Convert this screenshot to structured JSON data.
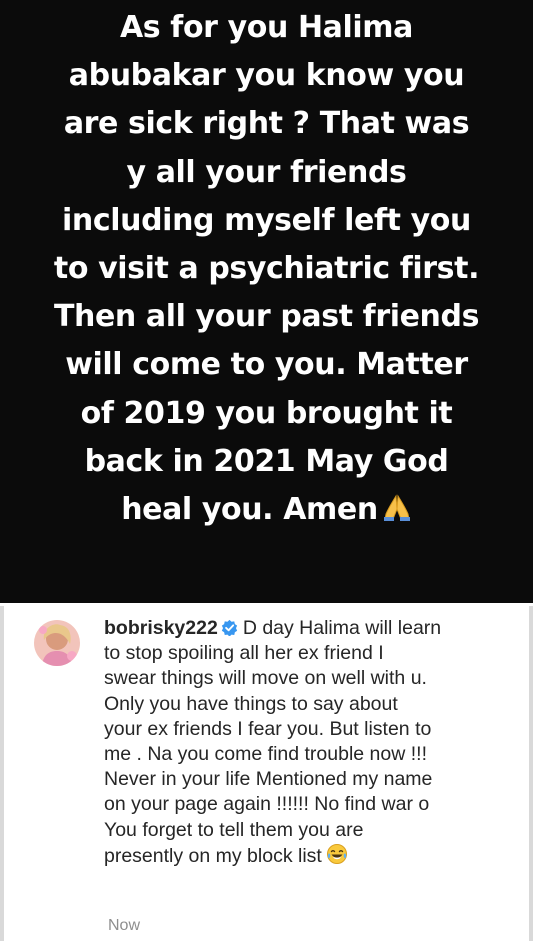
{
  "story": {
    "lines": [
      "As for you Halima",
      "abubakar you know you",
      "are sick right ? That was",
      "y all your friends",
      "including myself left you",
      "to visit a psychiatric first.",
      "Then all your past friends",
      "will come to you. Matter",
      "of 2019 you brought it",
      "back in 2021 May God",
      "heal you. Amen"
    ],
    "emoji_icon": "folded-hands-icon"
  },
  "comment": {
    "username": "bobrisky222",
    "verified_icon": "verified-badge-icon",
    "lines": [
      "D day Halima will learn",
      "to stop spoiling all her ex friend I",
      "swear things will move on well with u.",
      "Only you have things to say about",
      "your ex friends I fear you. But listen to",
      "me . Na you come find trouble now !!!",
      "Never in your life Mentioned my name",
      "on your page again !!!!!! No find war o",
      "You forget to tell them you are",
      "presently on my block list"
    ],
    "end_emoji_icon": "tears-of-joy-icon",
    "timestamp": "Now",
    "colors": {
      "text": "#262626",
      "muted": "#8e8e8e",
      "verified": "#3897f0"
    }
  }
}
